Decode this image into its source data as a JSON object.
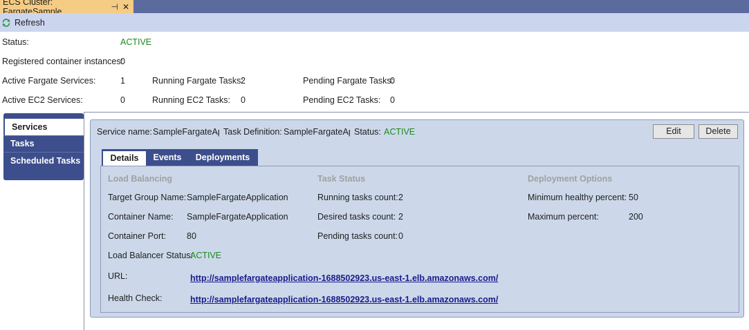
{
  "window": {
    "tab_title": "ECS Cluster: FargateSample",
    "pin_glyph": "⊣",
    "close_glyph": "✕"
  },
  "toolbar": {
    "refresh_label": "Refresh"
  },
  "summary": {
    "status_label": "Status:",
    "status_value": "ACTIVE",
    "registered_label": "Registered container instances:",
    "registered_value": "0",
    "active_fargate_label": "Active Fargate Services:",
    "active_fargate_value": "1",
    "running_fargate_label": "Running Fargate Tasks:",
    "running_fargate_value": "2",
    "pending_fargate_label": "Pending Fargate Tasks:",
    "pending_fargate_value": "0",
    "active_ec2_label": "Active EC2 Services:",
    "active_ec2_value": "0",
    "running_ec2_label": "Running EC2 Tasks:",
    "running_ec2_value": "0",
    "pending_ec2_label": "Pending EC2 Tasks:",
    "pending_ec2_value": "0"
  },
  "nav": {
    "items": [
      {
        "label": "Services"
      },
      {
        "label": "Tasks"
      },
      {
        "label": "Scheduled Tasks"
      }
    ]
  },
  "service": {
    "name_label": "Service name:",
    "name_value": "SampleFargateApp",
    "taskdef_label": "Task Definition:",
    "taskdef_value": "SampleFargateApp",
    "status_label": "Status:",
    "status_value": "ACTIVE",
    "edit_label": "Edit",
    "delete_label": "Delete"
  },
  "inner_tabs": [
    {
      "label": "Details"
    },
    {
      "label": "Events"
    },
    {
      "label": "Deployments"
    }
  ],
  "details": {
    "load_balancing_header": "Load Balancing",
    "task_status_header": "Task Status",
    "deployment_options_header": "Deployment Options",
    "target_group_label": "Target Group Name:",
    "target_group_value": "SampleFargateApplication",
    "container_name_label": "Container Name:",
    "container_name_value": "SampleFargateApplication",
    "container_port_label": "Container Port:",
    "container_port_value": "80",
    "lb_status_label": "Load Balancer Status:",
    "lb_status_value": "ACTIVE",
    "url_label": "URL:",
    "url_value": "http://samplefargateapplication-1688502923.us-east-1.elb.amazonaws.com/",
    "health_label": "Health Check:",
    "health_value": "http://samplefargateapplication-1688502923.us-east-1.elb.amazonaws.com/",
    "running_count_label": "Running tasks count:",
    "running_count_value": "2",
    "desired_count_label": "Desired tasks count:",
    "desired_count_value": "2",
    "pending_count_label": "Pending tasks count:",
    "pending_count_value": "0",
    "min_healthy_label": "Minimum healthy percent:",
    "min_healthy_value": "50",
    "max_percent_label": "Maximum percent:",
    "max_percent_value": "200"
  },
  "colors": {
    "active_status": "#1c8a1c",
    "nav_background": "#3d4e8c",
    "tab_highlight": "#f5cc84"
  }
}
